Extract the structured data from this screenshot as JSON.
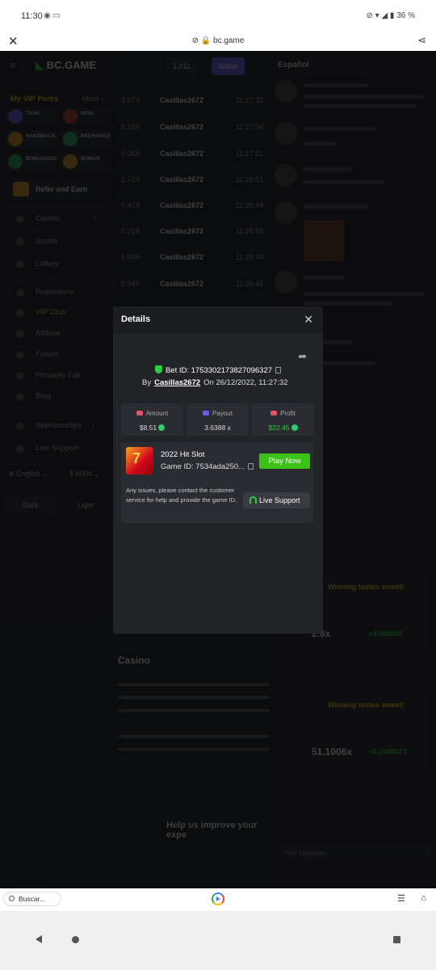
{
  "status_bar": {
    "time": "11:30",
    "left_icons": "◉ ▭",
    "right_icons": "⊘ ▾ ◢ ▮",
    "battery": "36 %"
  },
  "browser": {
    "url": "bc.game",
    "close_icon": "close-icon",
    "share_icon": "share-icon"
  },
  "sidebar": {
    "logo": "BC.GAME",
    "vip_title": "My VIP Perks",
    "more": "More ›",
    "perks": [
      "TASK",
      "SPIN",
      "RAKEBACK",
      "RECHARGE",
      "BONUSCOD",
      "BONUS"
    ],
    "refer": "Refer and Earn",
    "nav": [
      "Casino",
      "Sports",
      "Lottery",
      "Promotions",
      "VIP Club",
      "Affiliate",
      "Forum",
      "Provably Fair",
      "Blog",
      "Sponsorships",
      "Live Support"
    ],
    "language": "English",
    "currency": "$ MXN",
    "dark": "Dark",
    "light": "Light"
  },
  "center": {
    "wallet": "Wallet",
    "balance": "1,011",
    "rows": [
      {
        "amount": "4.07X",
        "user": "Casillas2672",
        "time": "11:27:32"
      },
      {
        "amount": "5.28X",
        "user": "Casillas2672",
        "time": "11:27:04"
      },
      {
        "amount": "0.06X",
        "user": "Casillas2672",
        "time": "11:27:01"
      },
      {
        "amount": "2.72X",
        "user": "Casillas2672",
        "time": "11:26:51"
      },
      {
        "amount": "0.47X",
        "user": "Casillas2672",
        "time": "11:26:48"
      },
      {
        "amount": "0.21X",
        "user": "Casillas2672",
        "time": "11:26:52"
      },
      {
        "amount": "6.60X",
        "user": "Casillas2672",
        "time": "11:26:49"
      },
      {
        "amount": "0.34X",
        "user": "Casillas2672",
        "time": "11:26:45"
      }
    ],
    "article_title": "Casino",
    "improve": "Help us improve your expe"
  },
  "chat": {
    "language": "Español",
    "cards": [
      {
        "title": "Winning tastes sweet!",
        "multiplier": "2.6x",
        "gain": "+4.000000"
      },
      {
        "title": "Winning tastes sweet!",
        "multiplier": "51.1006x",
        "gain": "+0.0388073"
      }
    ],
    "input_placeholder": "Your Message"
  },
  "modal": {
    "title": "Details",
    "bet_id_label": "Bet ID:",
    "bet_id": "1753302173827096327",
    "by_label": "By",
    "user": "Casillas2672",
    "on_label": "On",
    "date": "26/12/2022, 11:27:32",
    "stats": [
      {
        "label": "Amount",
        "value": "$8.51",
        "icon_color": "#e8516a"
      },
      {
        "label": "Payout",
        "value": "3.6388 x",
        "icon_color": "#6a5be2"
      },
      {
        "label": "Profit",
        "value": "$22.45",
        "icon_color": "#e8516a"
      }
    ],
    "game": {
      "name": "2022 Hit Slot",
      "game_id_label": "Game ID:",
      "game_id": "7534ada250...",
      "play": "Play Now",
      "thumb_text": "7"
    },
    "issues": "Any issues, please contact the customer service for help and provide the game ID.",
    "live_support": "Live Support"
  },
  "bottom_bar": {
    "search": "Buscar...",
    "tabs_icon": "☰",
    "home_icon": "⌂"
  },
  "colors": {
    "accent_green": "#3bc117",
    "vip_gold": "#f5c518",
    "modal_bg": "#232428"
  }
}
